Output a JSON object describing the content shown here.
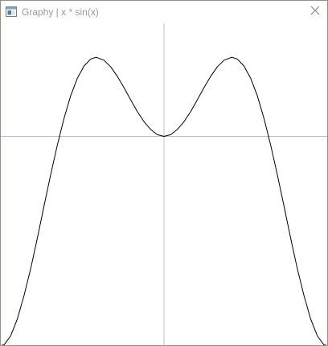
{
  "window": {
    "title": "Graphy | x * sin(x)",
    "app_icon": "graph-window-icon",
    "close_icon": "close-icon"
  },
  "chart_data": {
    "type": "line",
    "function": "x * sin(x)",
    "xlim": [
      -4.9,
      4.9
    ],
    "ylim": [
      -4.8,
      2.6
    ],
    "grid": false,
    "axes_color": "#c0c0c0",
    "line_color": "#000000",
    "series": [
      {
        "x": [
          -4.9,
          -4.8,
          -4.6,
          -4.4,
          -4.2,
          -4.0,
          -3.8,
          -3.6,
          -3.4,
          -3.2,
          -3.0,
          -2.8,
          -2.6,
          -2.4,
          -2.2,
          -2.029,
          -1.8,
          -1.6,
          -1.4,
          -1.2,
          -1.0,
          -0.8,
          -0.6,
          -0.4,
          -0.2,
          0.0,
          0.2,
          0.4,
          0.6,
          0.8,
          1.0,
          1.2,
          1.4,
          1.6,
          1.8,
          2.029,
          2.2,
          2.4,
          2.6,
          2.8,
          3.0,
          3.2,
          3.4,
          3.6,
          3.8,
          4.0,
          4.2,
          4.4,
          4.6,
          4.8,
          4.9
        ],
        "y": [
          -4.81,
          -4.79,
          -4.58,
          -4.19,
          -3.65,
          -3.03,
          -2.33,
          -1.59,
          -0.87,
          -0.19,
          0.42,
          0.94,
          1.34,
          1.62,
          1.78,
          1.82,
          1.75,
          1.6,
          1.38,
          1.12,
          0.84,
          0.57,
          0.34,
          0.16,
          0.04,
          0.0,
          0.04,
          0.16,
          0.34,
          0.57,
          0.84,
          1.12,
          1.38,
          1.6,
          1.75,
          1.82,
          1.78,
          1.62,
          1.34,
          0.94,
          0.42,
          -0.19,
          -0.87,
          -1.59,
          -2.33,
          -3.03,
          -3.65,
          -4.19,
          -4.58,
          -4.79,
          -4.81
        ]
      }
    ]
  }
}
